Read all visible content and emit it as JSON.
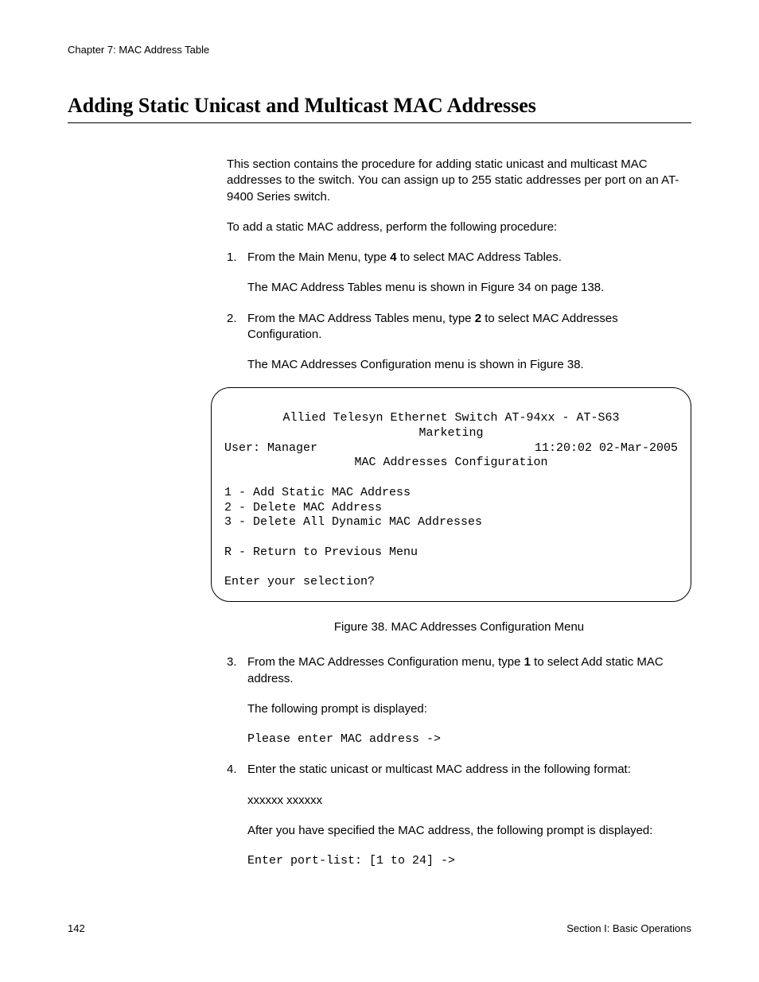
{
  "header": {
    "chapter": "Chapter 7: MAC Address Table"
  },
  "title": "Adding Static Unicast and Multicast MAC Addresses",
  "intro": "This section contains the procedure for adding static unicast and multicast MAC addresses to the switch. You can assign up to 255 static addresses per port on an AT-9400 Series switch.",
  "lead": "To add a static MAC address, perform the following procedure:",
  "steps": {
    "s1": {
      "num": "1.",
      "pre": "From the Main Menu, type ",
      "key": "4",
      "post": " to select MAC Address Tables.",
      "sub": "The MAC Address Tables menu is shown in Figure 34 on page 138."
    },
    "s2": {
      "num": "2.",
      "pre": "From the MAC Address Tables menu, type ",
      "key": "2",
      "post": " to select MAC Addresses Configuration.",
      "sub": "The MAC Addresses Configuration menu is shown in Figure 38."
    },
    "s3": {
      "num": "3.",
      "pre": "From the MAC Addresses Configuration menu, type ",
      "key": "1",
      "post": " to select Add static MAC address.",
      "sub": "The following prompt is displayed:",
      "prompt": "Please enter MAC address ->"
    },
    "s4": {
      "num": "4.",
      "text": "Enter the static unicast or multicast MAC address in the following format:",
      "format": "xxxxxx xxxxxx",
      "after": "After you have specified the MAC address, the following prompt is displayed:",
      "prompt": "Enter port-list: [1 to 24] ->"
    }
  },
  "terminal": {
    "title": "Allied Telesyn Ethernet Switch AT-94xx - AT-S63",
    "subtitle": "Marketing",
    "user": "User: Manager",
    "timestamp": "11:20:02 02-Mar-2005",
    "menu_title": "MAC Addresses Configuration",
    "opt1": "1 - Add Static MAC Address",
    "opt2": "2 - Delete MAC Address",
    "opt3": "3 - Delete All Dynamic MAC Addresses",
    "optR": "R - Return to Previous Menu",
    "prompt": "Enter your selection?"
  },
  "figure_caption": "Figure 38. MAC Addresses Configuration Menu",
  "footer": {
    "page": "142",
    "section": "Section I: Basic Operations"
  }
}
